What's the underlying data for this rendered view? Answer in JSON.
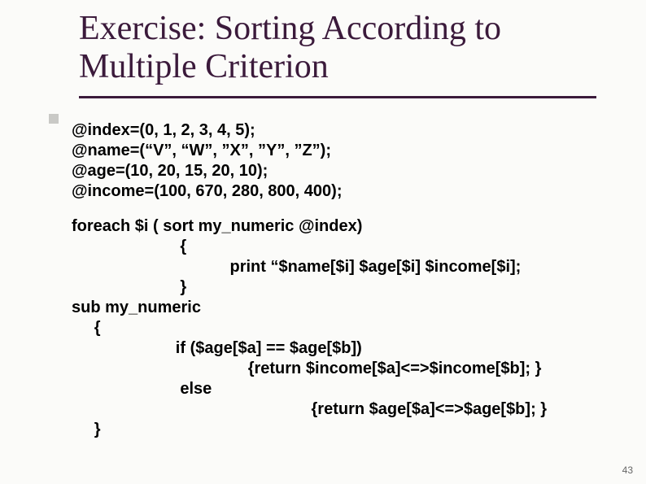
{
  "title": "Exercise: Sorting According to Multiple Criterion",
  "code": {
    "decl_index": "@index=(0, 1, 2, 3, 4, 5);",
    "decl_name": "@name=(“V”, “W”, ”X”, ”Y”, ”Z”);",
    "decl_age": "@age=(10, 20, 15, 20, 10);",
    "decl_income": "@income=(100, 670, 280, 800, 400);",
    "foreach": "foreach $i ( sort my_numeric @index)",
    "brace_open": "                        {",
    "print": "                                   print “$name[$i] $age[$i] $income[$i];",
    "brace_close": "                        }",
    "sub": "sub my_numeric",
    "sub_open": "     {",
    "if": "                       if ($age[$a] == $age[$b])",
    "if_ret": "                                       {return $income[$a]<=>$income[$b]; }",
    "else": "                        else",
    "else_ret": "                                                     {return $age[$a]<=>$age[$b]; }",
    "sub_close": "     }"
  },
  "page_number": "43"
}
